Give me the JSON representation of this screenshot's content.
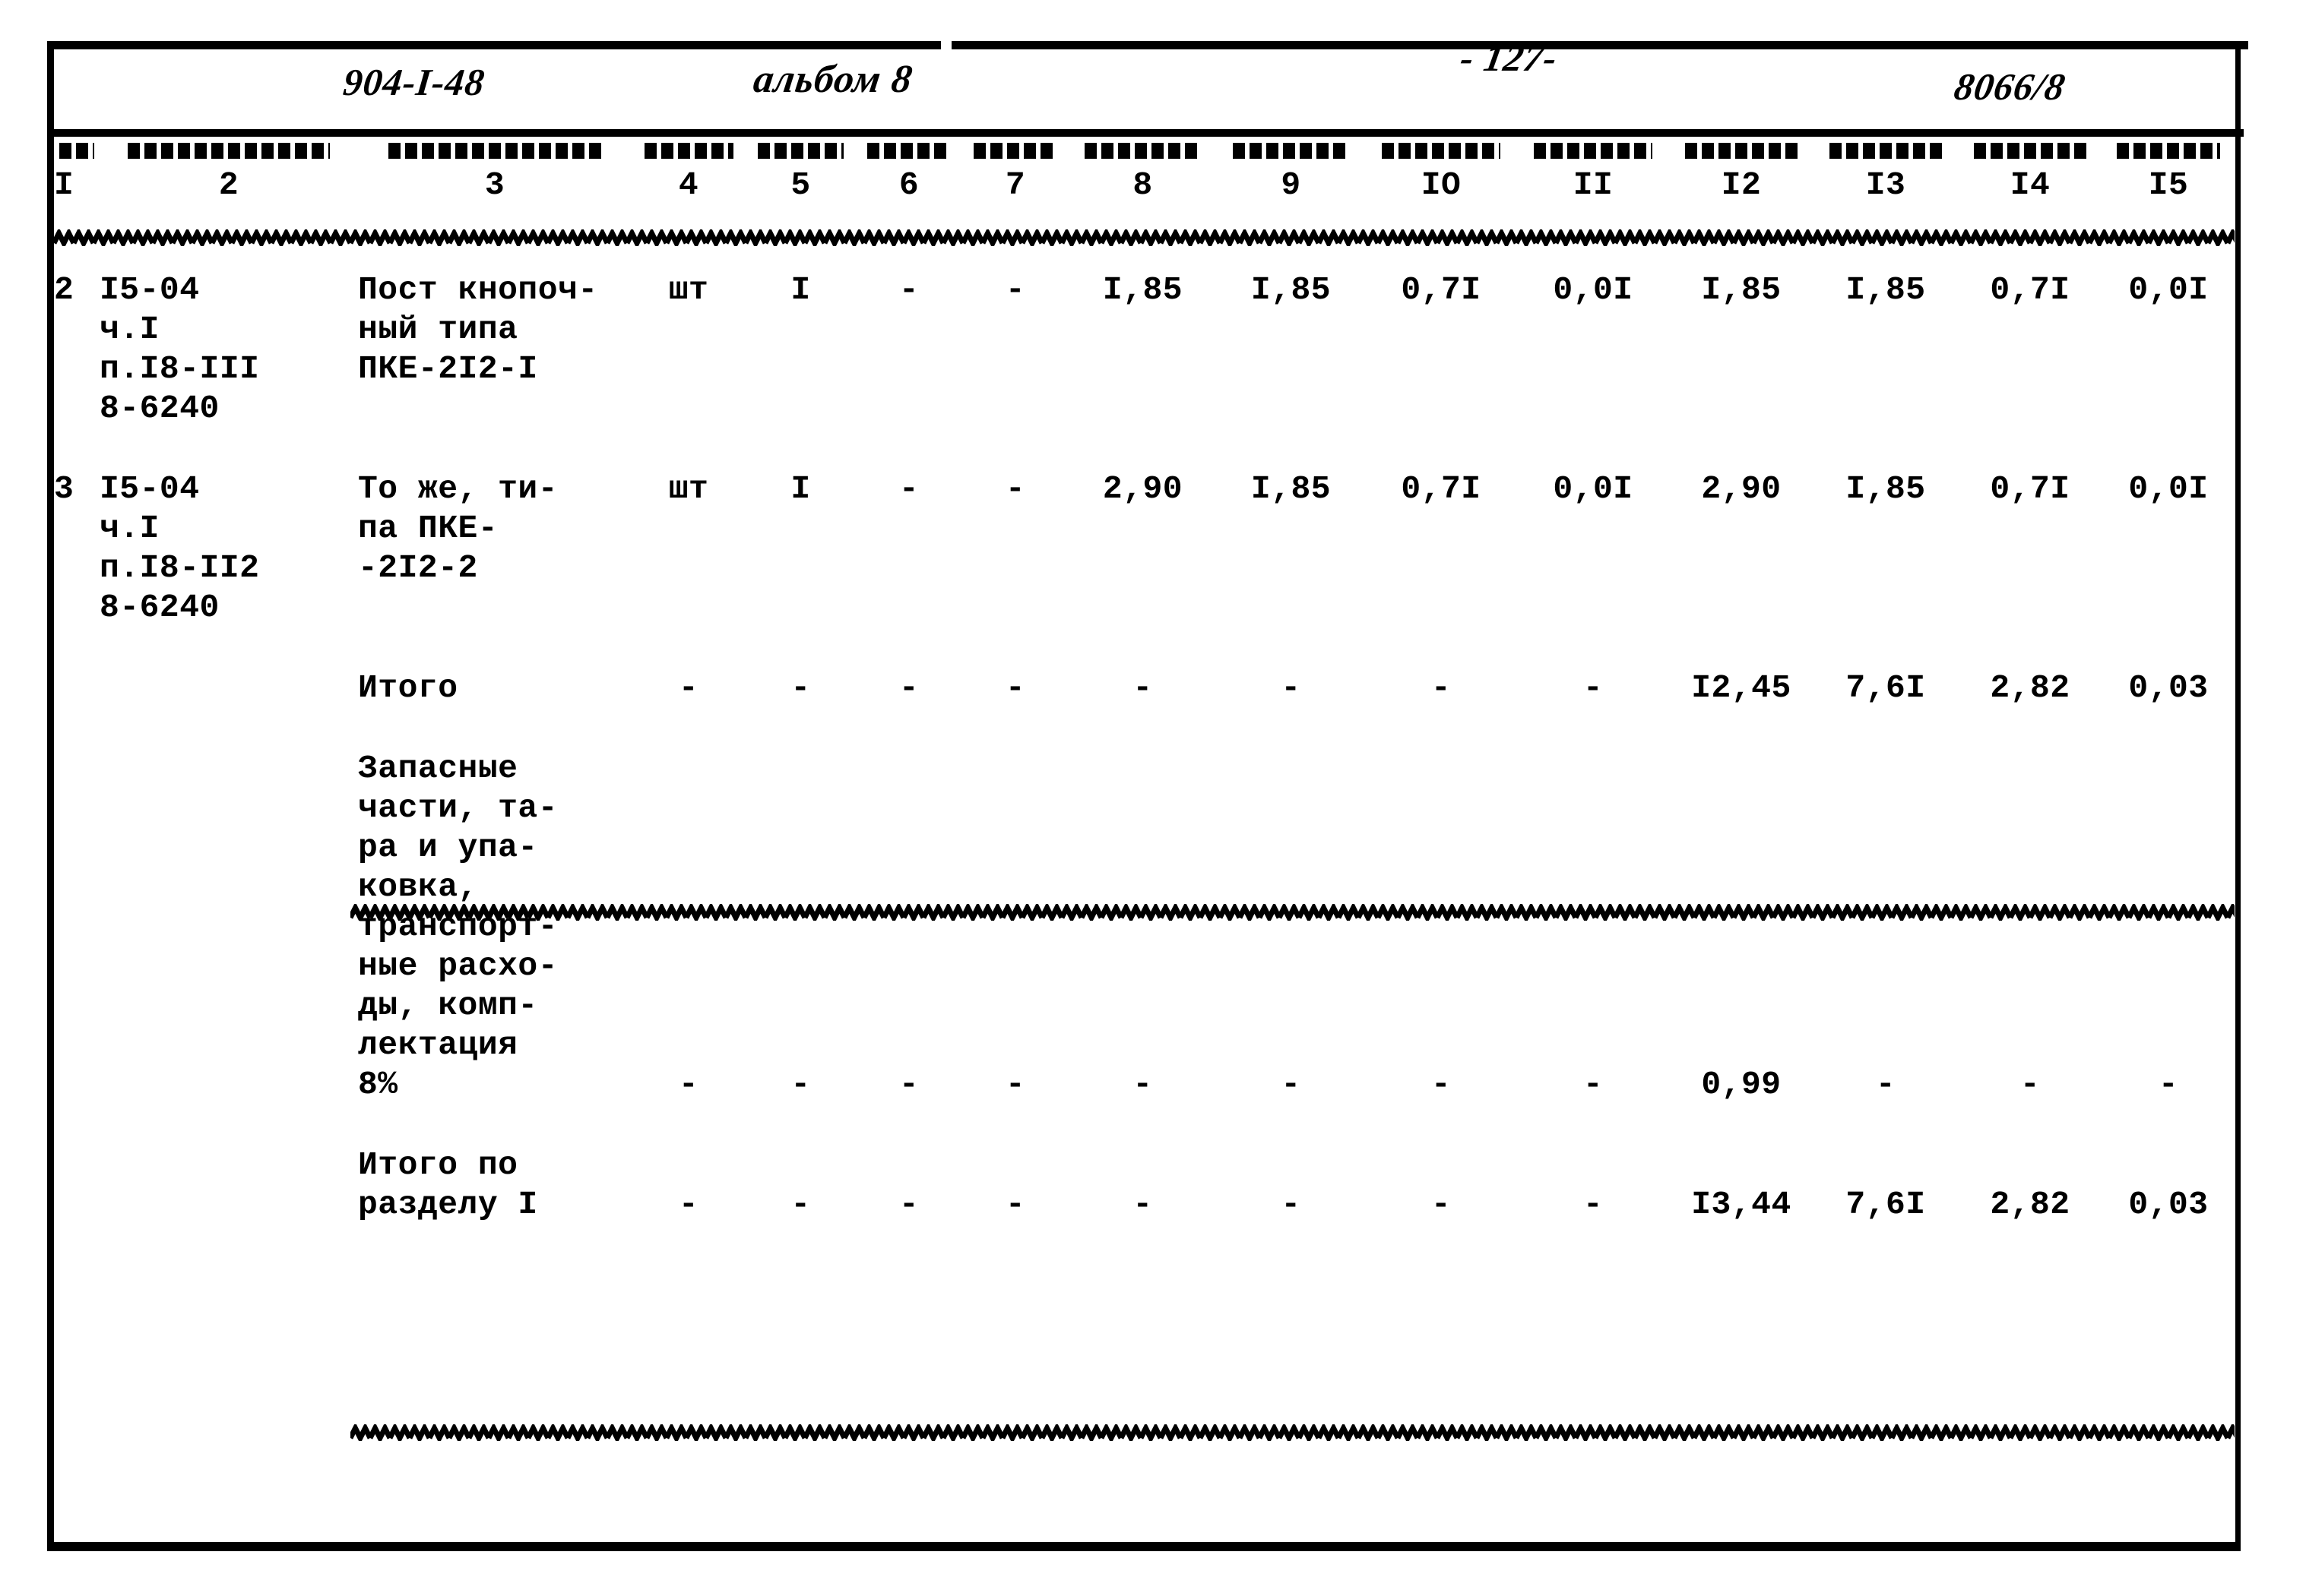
{
  "document": {
    "header": {
      "series_code": "904-I-48",
      "album": "альбом 8",
      "page_number": "- 127-",
      "sheet_code": "8066/8"
    }
  },
  "table": {
    "column_numbers": [
      "I",
      "2",
      "3",
      "4",
      "5",
      "6",
      "7",
      "8",
      "9",
      "IO",
      "II",
      "I2",
      "I3",
      "I4",
      "I5"
    ],
    "rows": [
      {
        "c1": "2",
        "c2": "I5-04\nч.I\nп.I8-III\n8-6240",
        "c3": "Пост кнопоч-\nный типа\nПКЕ-2I2-I",
        "c4": "шт",
        "c5": "I",
        "c6": "-",
        "c7": "-",
        "c8": "I,85",
        "c9": "I,85",
        "c10": "0,7I",
        "c11": "0,0I",
        "c12": "I,85",
        "c13": "I,85",
        "c14": "0,7I",
        "c15": "0,0I"
      },
      {
        "c1": "3",
        "c2": "I5-04\nч.I\nп.I8-II2\n8-6240",
        "c3": "То же, ти-\nпа ПКЕ-\n-2I2-2",
        "c4": "шт",
        "c5": "I",
        "c6": "-",
        "c7": "-",
        "c8": "2,90",
        "c9": "I,85",
        "c10": "0,7I",
        "c11": "0,0I",
        "c12": "2,90",
        "c13": "I,85",
        "c14": "0,7I",
        "c15": "0,0I"
      },
      {
        "c1": "",
        "c2": "",
        "c3": "Итого",
        "c4": "-",
        "c5": "-",
        "c6": "-",
        "c7": "-",
        "c8": "-",
        "c9": "-",
        "c10": "-",
        "c11": "-",
        "c12": "I2,45",
        "c13": "7,6I",
        "c14": "2,82",
        "c15": "0,03"
      },
      {
        "c1": "",
        "c2": "",
        "c3": "Запасные\nчасти, та-\nра и упа-\nковка,\nтранспорт-\nные расхо-\nды, комп-\nлектация\n8%",
        "c4": "-",
        "c5": "-",
        "c6": "-",
        "c7": "-",
        "c8": "-",
        "c9": "-",
        "c10": "-",
        "c11": "-",
        "c12": "0,99",
        "c13": "-",
        "c14": "-",
        "c15": "-"
      },
      {
        "c1": "",
        "c2": "",
        "c3": "Итого по\nразделу I",
        "c4": "-",
        "c5": "-",
        "c6": "-",
        "c7": "-",
        "c8": "-",
        "c9": "-",
        "c10": "-",
        "c11": "-",
        "c12": "I3,44",
        "c13": "7,6I",
        "c14": "2,82",
        "c15": "0,03"
      }
    ]
  }
}
